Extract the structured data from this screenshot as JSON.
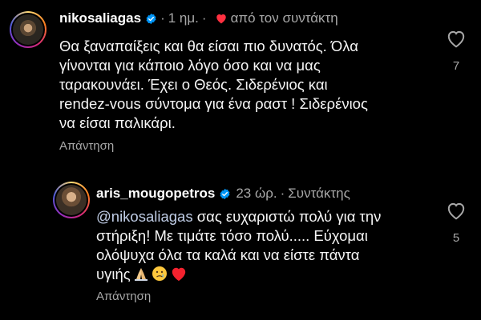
{
  "comments": [
    {
      "username": "nikosaliagas",
      "time": "1 ημ.",
      "liked_by_author_label": "από τον συντάκτη",
      "lines": [
        "Θα ξαναπαίξεις και θα είσαι πιο δυνατός. Όλα",
        "γίνονται για κάποιο λόγο όσο και να μας",
        "ταρακουνάει. Έχει ο Θεός. Σιδερένιος και",
        "rendez-vous σύντομα για ένα ραστ ! Σιδερένιος",
        "να είσαι παλικάρι."
      ],
      "reply_label": "Απάντηση",
      "likes": "7"
    },
    {
      "username": "aris_mougopetros",
      "time": "23 ώρ.",
      "role": "Συντάκτης",
      "mention": "@nikosaliagas",
      "first_line_rest": " σας ευχαριστώ πολύ για την",
      "lines": [
        "στήριξη! Με τιμάτε τόσο πολύ..... Εύχομαι",
        "ολόψυχα όλα τα καλά και να είστε πάντα",
        "υγιής"
      ],
      "emojis": [
        "folded-hands",
        "crying-face",
        "red-heart"
      ],
      "reply_label": "Απάντηση",
      "likes": "5"
    }
  ],
  "colors": {
    "background": "#000000",
    "verified": "#0095f6",
    "heart": "#ff3040",
    "secondary_text": "#a8a8a8",
    "mention": "#c0cde6"
  }
}
